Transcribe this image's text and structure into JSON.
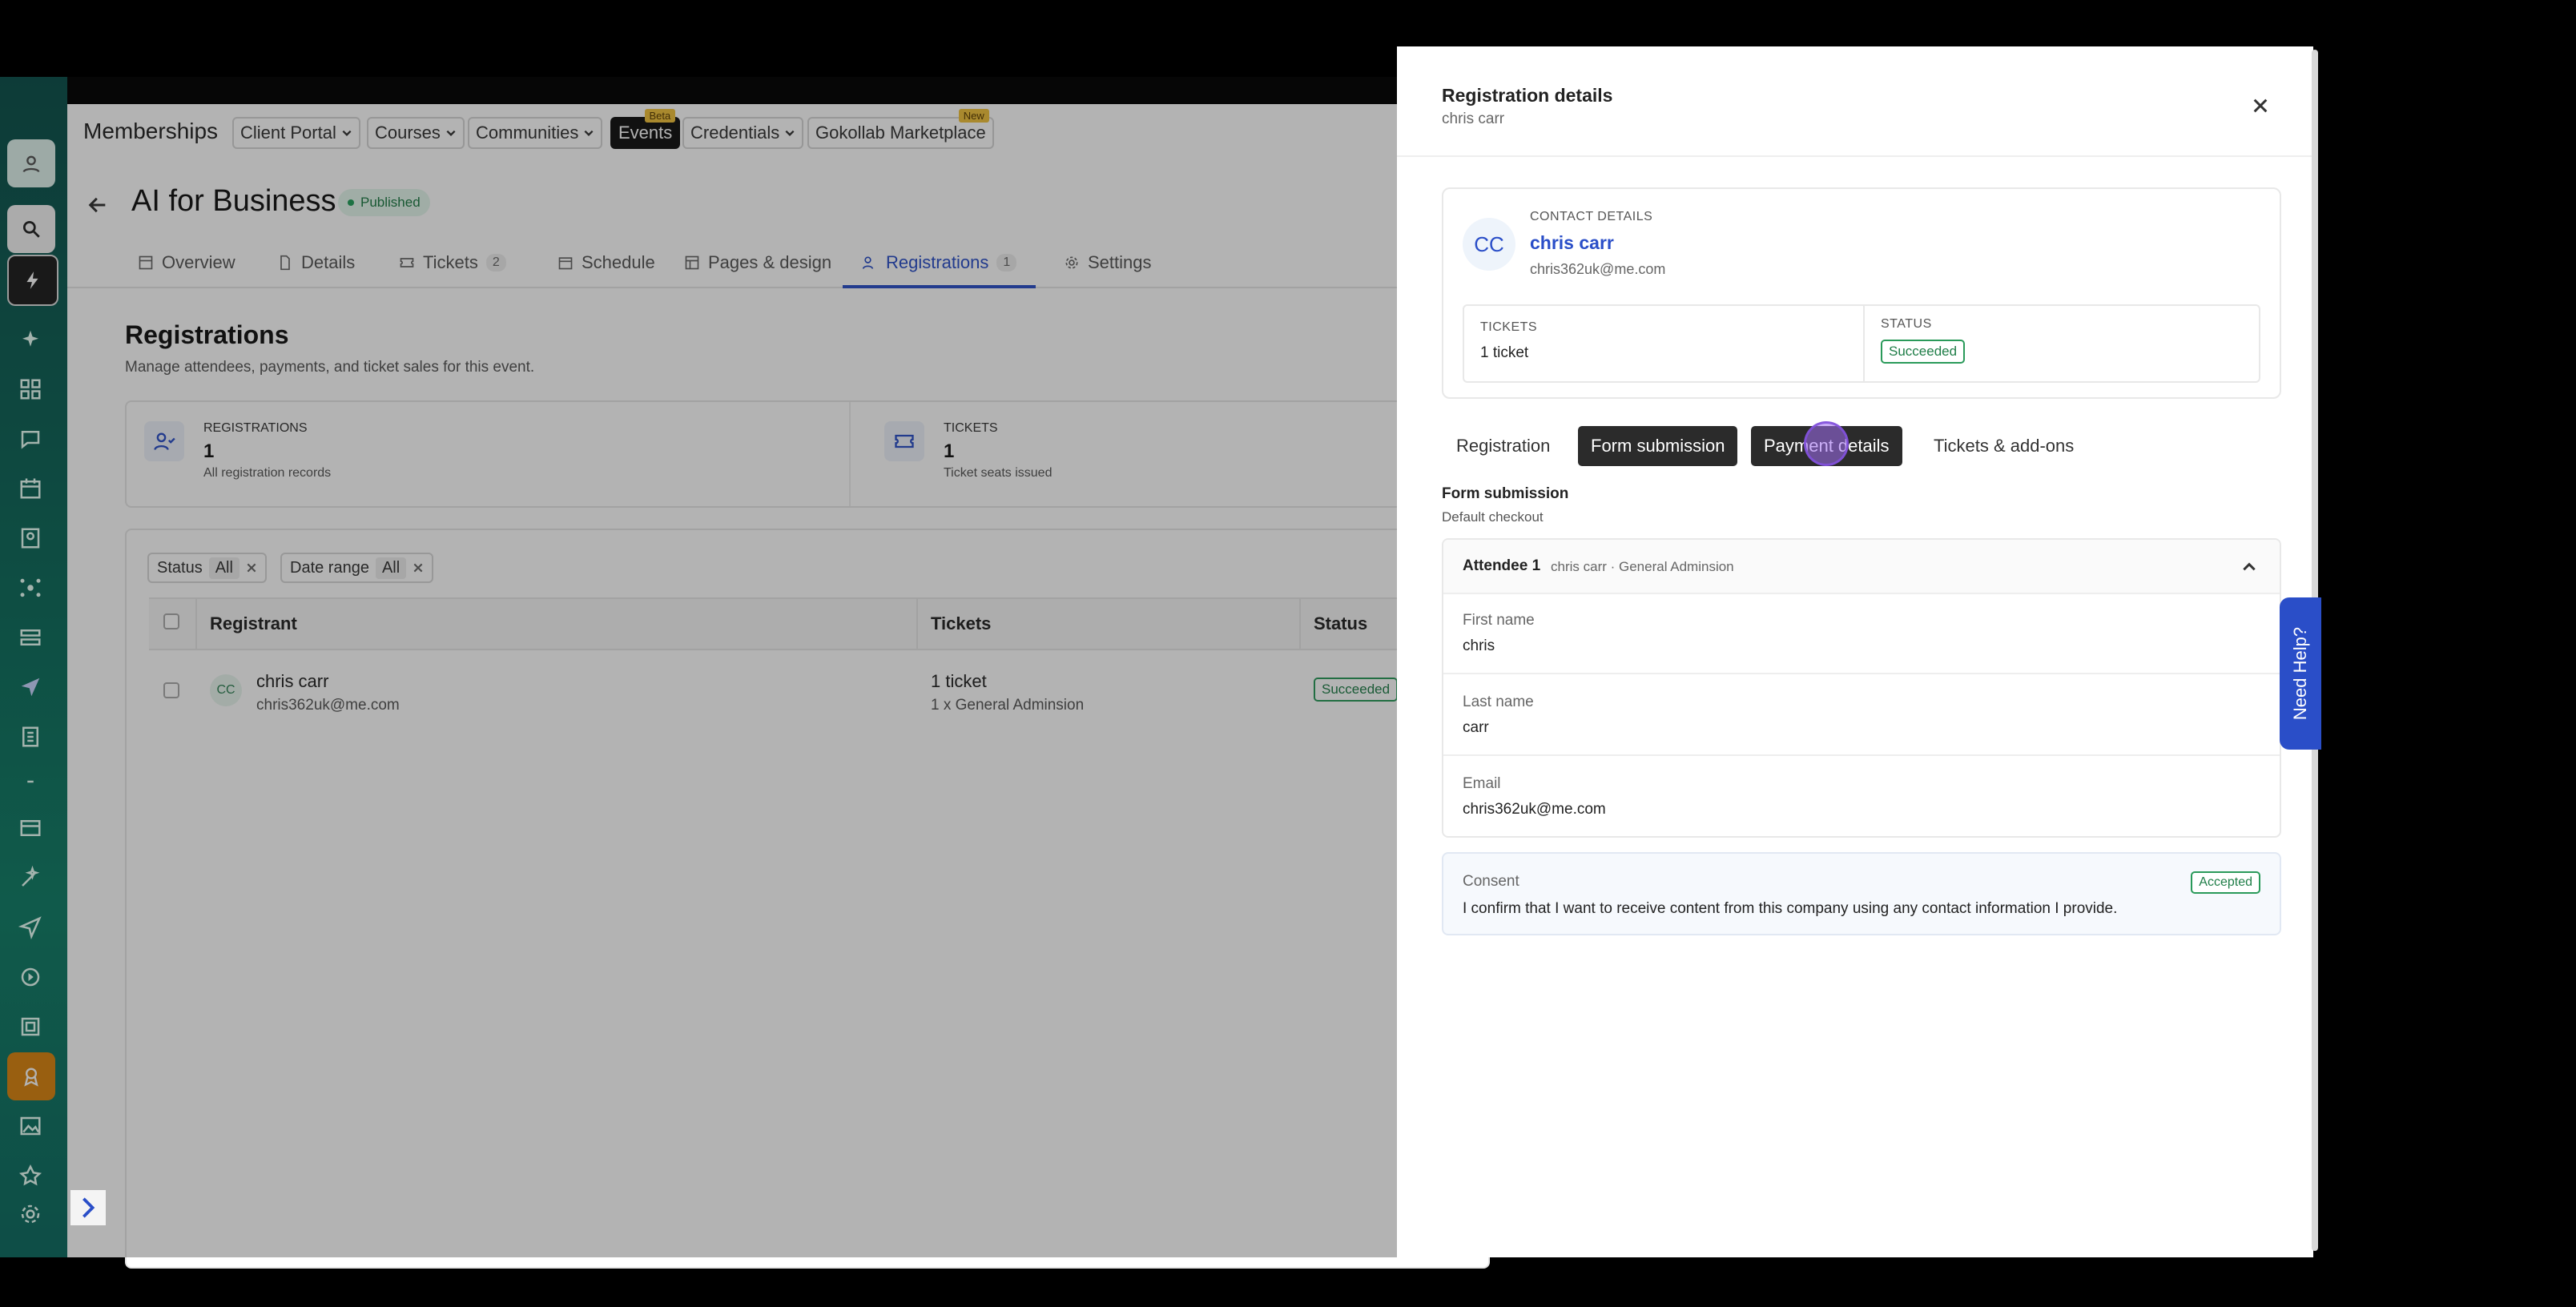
{
  "colors": {
    "accent": "#2a4ec8",
    "success": "#1e7d47",
    "rail": "#0d6b5b"
  },
  "app": {
    "brand": "Memberships",
    "nav": [
      {
        "label": "Client Portal"
      },
      {
        "label": "Courses"
      },
      {
        "label": "Communities"
      },
      {
        "label": "Events",
        "tag": "Beta"
      },
      {
        "label": "Credentials"
      },
      {
        "label": "Gokollab Marketplace",
        "tag": "New"
      }
    ],
    "event": {
      "title": "AI for Business",
      "status": "Published"
    },
    "tabs": [
      {
        "label": "Overview"
      },
      {
        "label": "Details"
      },
      {
        "label": "Tickets",
        "count": "2"
      },
      {
        "label": "Schedule"
      },
      {
        "label": "Pages & design"
      },
      {
        "label": "Registrations",
        "count": "1"
      },
      {
        "label": "Settings"
      }
    ],
    "section": {
      "title": "Registrations",
      "subtitle": "Manage attendees, payments, and ticket sales for this event."
    },
    "stats": [
      {
        "label": "Registrations",
        "value": "1",
        "sub": "All registration records"
      },
      {
        "label": "Tickets",
        "value": "1",
        "sub": "Ticket seats issued"
      }
    ],
    "filters": [
      {
        "label": "Status",
        "value": "All"
      },
      {
        "label": "Date range",
        "value": "All"
      }
    ],
    "table": {
      "headers": {
        "registrant": "Registrant",
        "tickets": "Tickets",
        "status": "Status"
      },
      "rows": [
        {
          "initials": "CC",
          "name": "chris carr",
          "email": "chris362uk@me.com",
          "tickets": "1 ticket",
          "ticket_detail": "1 x General Adminsion",
          "status": "Succeeded"
        }
      ]
    }
  },
  "drawer": {
    "title": "Registration details",
    "subtitle": "chris carr",
    "contact": {
      "label": "Contact details",
      "initials": "CC",
      "name": "chris carr",
      "email": "chris362uk@me.com"
    },
    "tickets_label": "Tickets",
    "tickets_value": "1 ticket",
    "status_label": "Status",
    "status_value": "Succeeded",
    "segments": [
      "Registration",
      "Form submission",
      "Payment details",
      "Tickets & add-ons"
    ],
    "form": {
      "title": "Form submission",
      "subtitle": "Default checkout",
      "attendee_label": "Attendee 1",
      "attendee_meta": "chris carr · General Adminsion",
      "fields": [
        {
          "label": "First name",
          "value": "chris"
        },
        {
          "label": "Last name",
          "value": "carr"
        },
        {
          "label": "Email",
          "value": "chris362uk@me.com"
        }
      ],
      "consent": {
        "label": "Consent",
        "text": "I confirm that I want to receive content from this company using any contact information I provide.",
        "badge": "Accepted"
      }
    }
  },
  "help": {
    "label": "Need Help?"
  }
}
